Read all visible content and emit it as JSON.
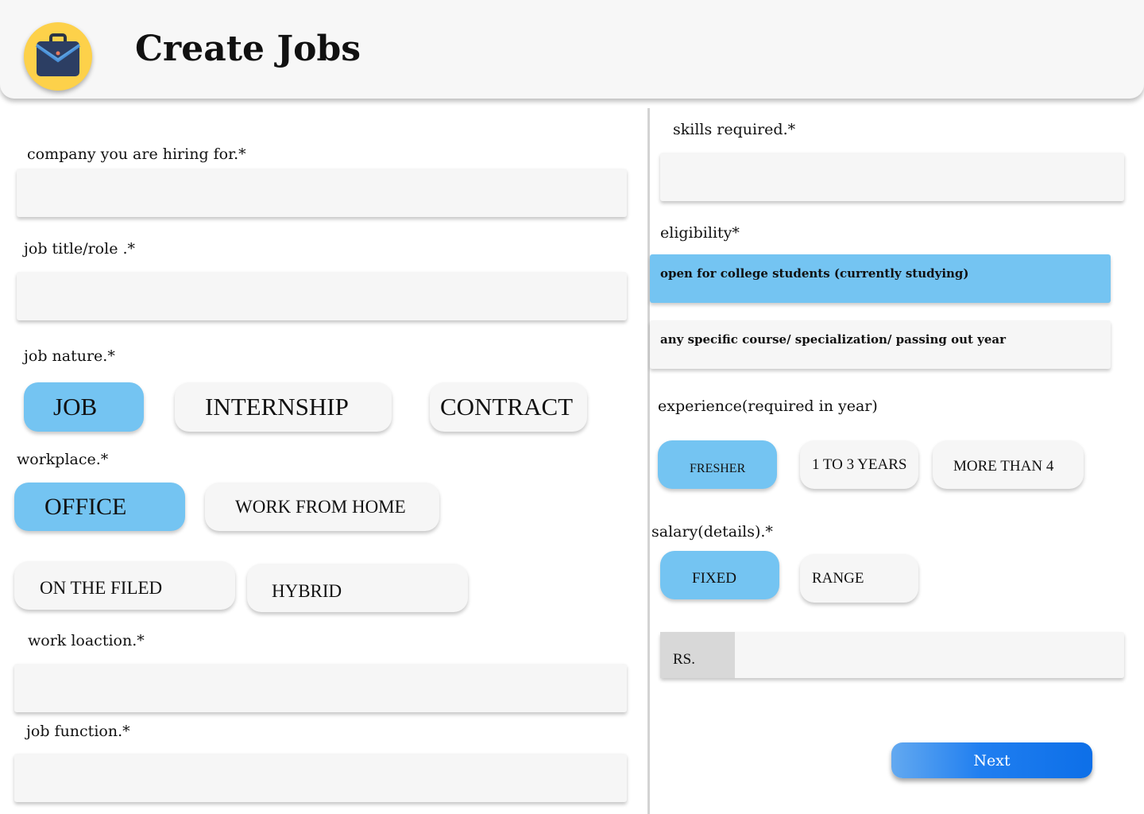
{
  "header": {
    "title": "Create Jobs",
    "logo_icon": "briefcase-icon"
  },
  "left": {
    "company_label": "company you are hiring for.*",
    "company_value": "",
    "job_title_label": "job title/role .*",
    "job_title_value": "",
    "job_nature_label": "job nature.*",
    "job_nature_options": [
      "JOB",
      "INTERNSHIP",
      "CONTRACT"
    ],
    "job_nature_selected": "JOB",
    "workplace_label": "workplace.*",
    "workplace_options": [
      "OFFICE",
      "WORK FROM HOME",
      "ON THE FILED",
      "HYBRID"
    ],
    "workplace_selected": "OFFICE",
    "work_location_label": "work loaction.*",
    "work_location_value": "",
    "job_function_label": "job function.*",
    "job_function_value": ""
  },
  "right": {
    "skills_label": "skills required.*",
    "skills_value": "",
    "eligibility_label": "eligibility*",
    "eligibility_options": [
      "open for college students (currently studying)",
      "any specific course/ specialization/ passing out year"
    ],
    "eligibility_selected": "open for college students (currently studying)",
    "experience_label": "experience(required in year)",
    "experience_options": [
      "FRESHER",
      "1 TO 3 YEARS",
      "MORE THAN 4"
    ],
    "experience_selected": "FRESHER",
    "salary_label": "salary(details).*",
    "salary_options": [
      "FIXED",
      "RANGE"
    ],
    "salary_selected": "FIXED",
    "salary_prefix": "RS.",
    "salary_value": "",
    "next_label": "Next"
  },
  "colors": {
    "selected": "#74c4f2",
    "logo_bg": "#fdd14a",
    "next_button": "#1f7ef0"
  }
}
